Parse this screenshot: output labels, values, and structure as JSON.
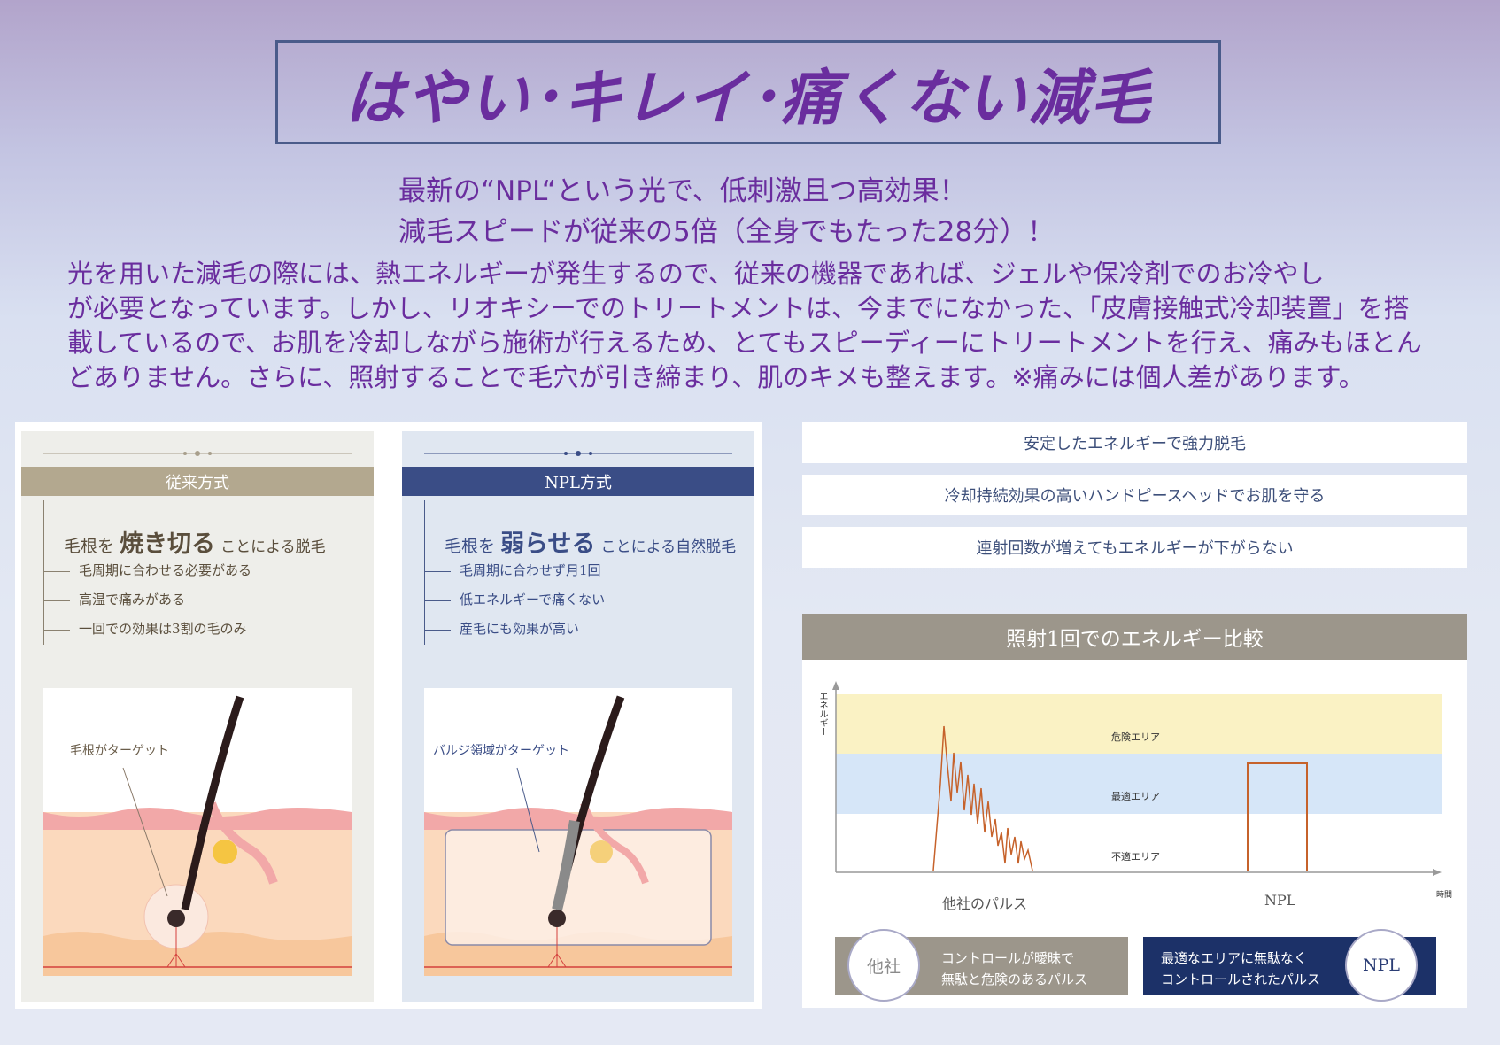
{
  "header": {
    "title": "はやい･キレイ･痛くない減毛",
    "subline1": "最新の“NPL“という光で、低刺激且つ高効果！",
    "subline2": "減毛スピードが従来の5倍（全身でもたった28分）！"
  },
  "intro": {
    "lines": [
      "光を用いた減毛の際には、熱エネルギーが発生するので、従来の機器であれば、ジェルや保冷剤でのお冷やし",
      "が必要となっています。しかし、リオキシーでのトリートメントは、今までになかった、「皮膚接触式冷却装置」を搭",
      "載しているので、お肌を冷却しながら施術が行えるため、とてもスピーディーにトリートメントを行え、痛みもほとん",
      "どありません。さらに、照射することで毛穴が引き締まり、肌のキメも整えます。※痛みには個人差があります。"
    ]
  },
  "conventional": {
    "header": "従来方式",
    "head_pre": "毛根を",
    "head_big": "焼き切る",
    "head_post": "ことによる脱毛",
    "items": [
      "毛周期に合わせる必要がある",
      "高温で痛みがある",
      "一回での効果は3割の毛のみ"
    ],
    "illus_label": "毛根がターゲット"
  },
  "npl": {
    "header": "NPL方式",
    "head_pre": "毛根を",
    "head_big": "弱らせる",
    "head_post": "ことによる自然脱毛",
    "items": [
      "毛周期に合わせず月1回",
      "低エネルギーで痛くない",
      "産毛にも効果が高い"
    ],
    "illus_label": "バルジ領域がターゲット"
  },
  "features": [
    "安定したエネルギーで強力脱毛",
    "冷却持続効果の高いハンドピースヘッドでお肌を守る",
    "連射回数が増えてもエネルギーが下がらない"
  ],
  "energy": {
    "title": "照射1回でのエネルギー比較",
    "y_label": "エネルギー",
    "zones": [
      "危険エリア",
      "最適エリア",
      "不適エリア"
    ],
    "x_label_other": "他社のパルス",
    "x_label_npl": "NPL",
    "time_label": "時間",
    "other_circle": "他社",
    "other_text1": "コントロールが曖昧で",
    "other_text2": "無駄と危険のあるパルス",
    "npl_circle": "NPL",
    "npl_text1": "最適なエリアに無駄なく",
    "npl_text2": "コントロールされたパルス",
    "colors": {
      "danger": "#faf2c4",
      "optimal": "#d6e6f8",
      "pulse": "#c6622b"
    }
  }
}
